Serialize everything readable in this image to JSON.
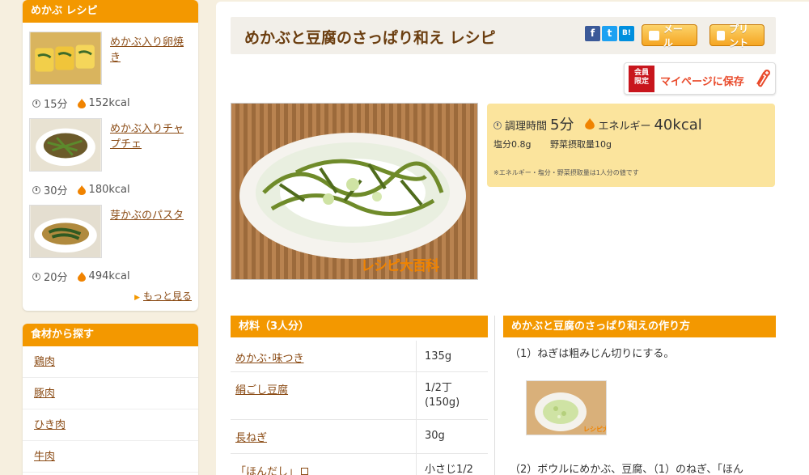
{
  "sidebar": {
    "recipes_head": "めかぶ レシピ",
    "recipes": [
      {
        "title_l1": "めかぶ入り卵焼",
        "title_l2": "き",
        "time": "15分",
        "kcal": "152kcal"
      },
      {
        "title_l1": "めかぶ入りチャ",
        "title_l2": "プチェ",
        "time": "30分",
        "kcal": "180kcal"
      },
      {
        "title_l1": "芽かぶのパスタ",
        "title_l2": "",
        "time": "20分",
        "kcal": "494kcal"
      }
    ],
    "more": "もっと見る",
    "ingredients_head": "食材から探す",
    "ingredients": [
      "鶏肉",
      "豚肉",
      "ひき肉",
      "牛肉"
    ]
  },
  "header": {
    "title": "めかぶと豆腐のさっぱり和え レシピ",
    "social": [
      "f",
      "t",
      "B!"
    ],
    "mail": "メール",
    "print": "プリント",
    "member_l1": "会員",
    "member_l2": "限定",
    "save": "マイページに保存"
  },
  "photo": {
    "logo": "レシピ大百科"
  },
  "info": {
    "time_label": "調理時間",
    "time_value": "5分",
    "energy_label": "エネルギー",
    "energy_value": "40kcal",
    "salt": "塩分0.8g",
    "veg": "野菜摂取量10g",
    "note": "※エネルギー・塩分・野菜摂取量は1人分の値です"
  },
  "ingredients_section": {
    "head": "材料（3人分）",
    "rows": [
      {
        "name": "めかぶ･味つき",
        "qty_l1": "135g",
        "qty_l2": ""
      },
      {
        "name": "絹ごし豆腐",
        "qty_l1": "1/2丁",
        "qty_l2": "(150g)"
      },
      {
        "name": "長ねぎ",
        "qty_l1": "30g",
        "qty_l2": ""
      },
      {
        "name": "「ほんだし」",
        "qty_l1": "小さじ1/2",
        "qty_l2": ""
      }
    ]
  },
  "steps_section": {
    "head": "めかぶと豆腐のさっぱり和えの作り方",
    "step1": "（1）ねぎは粗みじん切りにする。",
    "step1_logo": "レシピ大百科",
    "step2": "（2）ボウルにめかぶ、豆腐、（1）のねぎ、「ほん"
  },
  "colors": {
    "accent": "#f39800",
    "link": "#8a4a13",
    "info_bg": "#fbe49d",
    "member_red": "#c8161d"
  }
}
